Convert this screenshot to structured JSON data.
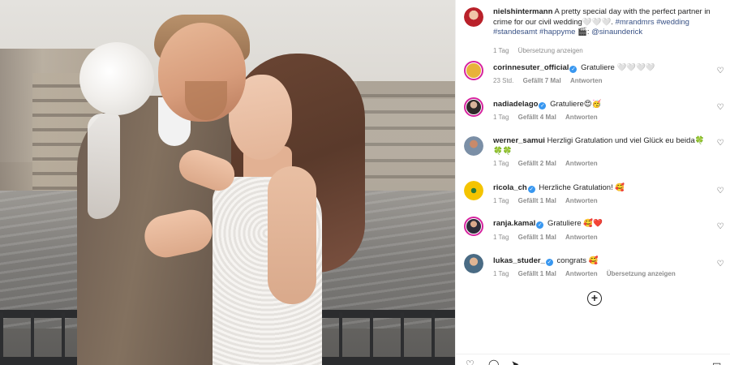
{
  "post": {
    "author": "nielshintermann",
    "caption_text": "A pretty special day with the perfect partner in crime for our civil wedding🤍🤍🤍.",
    "hashtags": "#mrandmrs #wedding #standesamt #happyme",
    "mention_prefix": "🎬: ",
    "mention": "@sinaunderick",
    "time": "1 Tag",
    "translate": "Übersetzung anzeigen"
  },
  "comments": [
    {
      "user": "corinnesuter_official",
      "verified": true,
      "text": "Gratuliere 🤍🤍🤍🤍",
      "time": "23 Std.",
      "likes": "Gefällt 7 Mal",
      "reply": "Antworten",
      "avatar_color": "#e8b23a"
    },
    {
      "user": "nadiadelago",
      "verified": true,
      "text": "Gratuliere😍🥳",
      "time": "1 Tag",
      "likes": "Gefällt 4 Mal",
      "reply": "Antworten",
      "avatar_color": "#2f2a2a"
    },
    {
      "user": "werner_samui",
      "verified": false,
      "text": "Herzligi Gratulation und viel Glück eu beida🍀",
      "text2": "🍀🍀",
      "time": "1 Tag",
      "likes": "Gefällt 2 Mal",
      "reply": "Antworten",
      "avatar_color": "#7b8fa6"
    },
    {
      "user": "ricola_ch",
      "verified": true,
      "text": "Herzliche Gratulation! 🥰",
      "time": "1 Tag",
      "likes": "Gefällt 1 Mal",
      "reply": "Antworten",
      "avatar_color": "#f4c400"
    },
    {
      "user": "ranja.kamal",
      "verified": true,
      "text": "Gratuliere 🥰❤️",
      "time": "1 Tag",
      "likes": "Gefällt 1 Mal",
      "reply": "Antworten",
      "avatar_color": "#2d2d3a"
    },
    {
      "user": "lukas_studer_",
      "verified": true,
      "text": "congrats 🥰",
      "time": "1 Tag",
      "likes": "Gefällt 1 Mal",
      "reply": "Antworten",
      "translate": "Übersetzung anzeigen",
      "avatar_color": "#4a6b84"
    }
  ],
  "icons": {
    "heart": "♡",
    "load_more": "+",
    "verified": "✓",
    "like_action": "♡",
    "comment_action": "◯",
    "share_action": "➤",
    "save_action": "▭"
  },
  "colors": {
    "link": "#385185",
    "verified": "#3897f0",
    "muted": "#8e8e8e",
    "story_ring": "#d6249f"
  }
}
